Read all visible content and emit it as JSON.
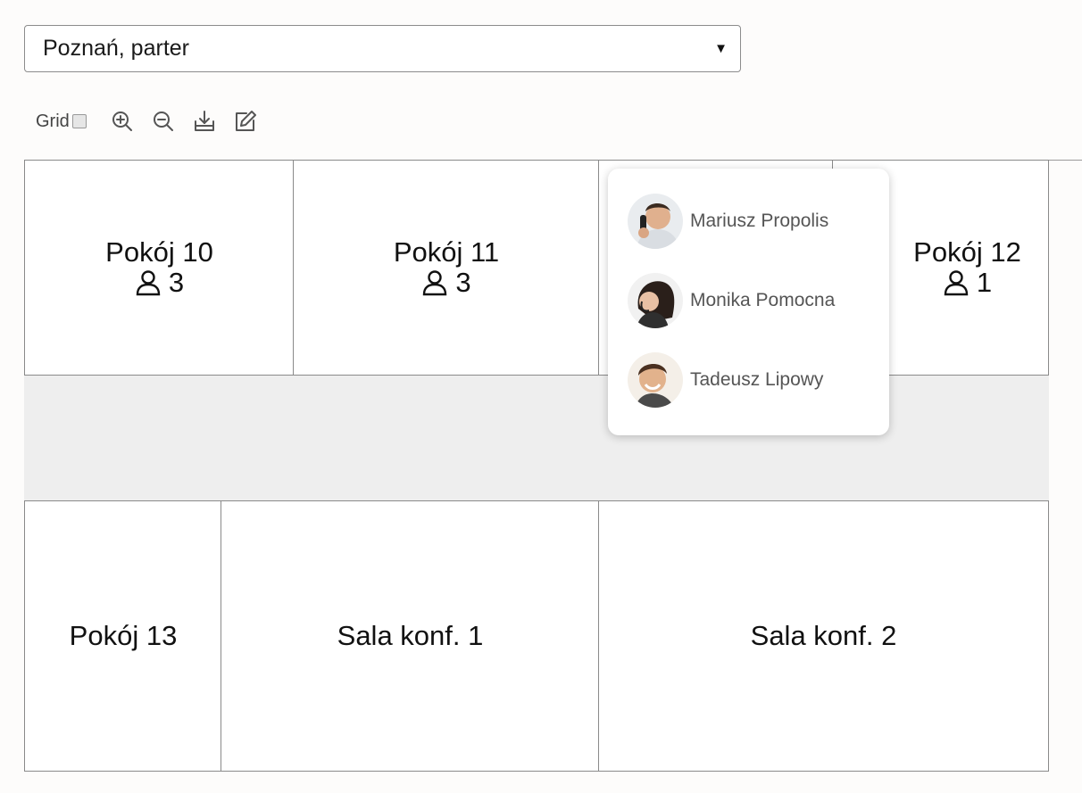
{
  "location_select": {
    "value": "Poznań, parter"
  },
  "toolbar": {
    "grid_label": "Grid",
    "grid_checked": false,
    "icons": [
      "zoom-in-icon",
      "zoom-out-icon",
      "download-icon",
      "edit-icon"
    ]
  },
  "rooms": [
    {
      "name": "Pokój 10",
      "occupants": "3"
    },
    {
      "name": "Pokój 11",
      "occupants": "3"
    },
    {
      "name": "Pokój 12",
      "occupants": "1"
    },
    {
      "name": "Pokój 13"
    },
    {
      "name": "Sala konf. 1"
    },
    {
      "name": "Sala konf. 2"
    }
  ],
  "popup": {
    "people": [
      {
        "name": "Mariusz Propolis"
      },
      {
        "name": "Monika Pomocna"
      },
      {
        "name": "Tadeusz Lipowy"
      }
    ]
  },
  "colors": {
    "corridor": "#eeeeee",
    "room_border": "#8a8a8a",
    "background": "#fdfcfb"
  }
}
